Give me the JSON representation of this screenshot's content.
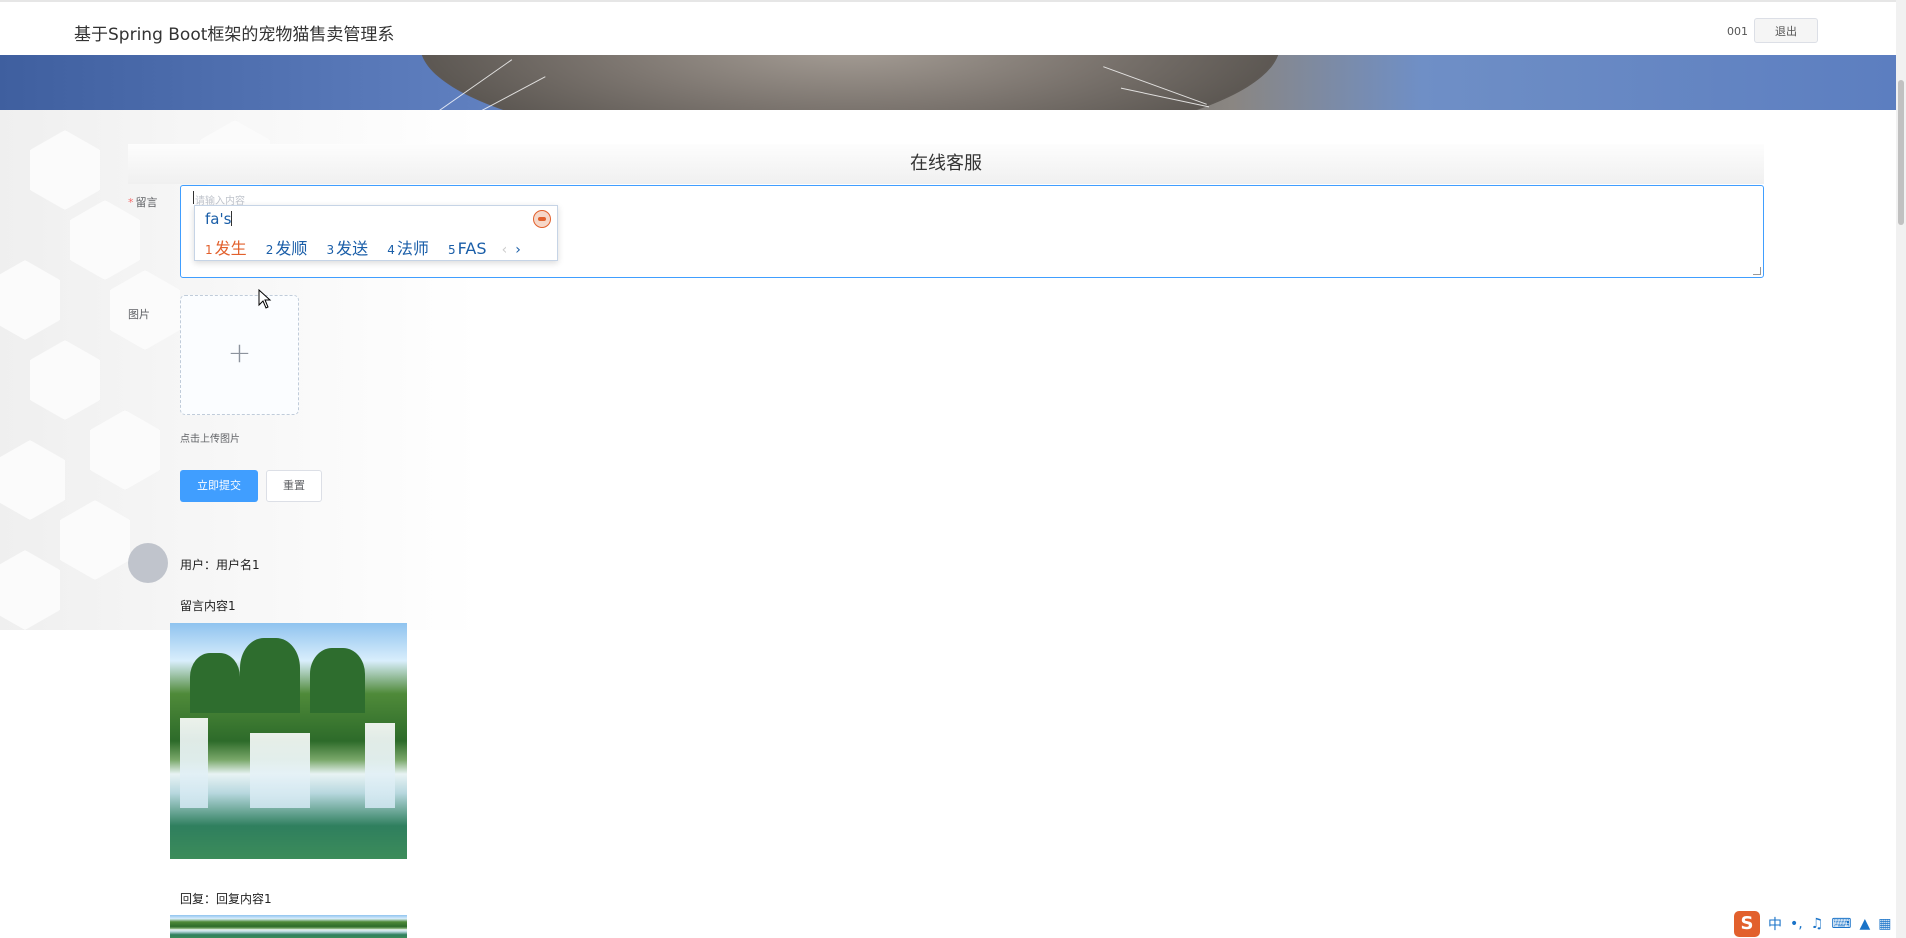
{
  "header": {
    "site_title": "基于Spring Boot框架的宠物猫售卖管理系",
    "user_id": "001",
    "logout_label": "退出"
  },
  "section": {
    "title": "在线客服"
  },
  "form": {
    "message_label": "留言",
    "required_mark": "*",
    "message_placeholder": "请输入内容",
    "image_label": "图片",
    "upload_hint": "点击上传图片",
    "submit_label": "立即提交",
    "reset_label": "重置"
  },
  "ime": {
    "pinyin": "fa's",
    "candidates": [
      {
        "num": "1",
        "text": "发生"
      },
      {
        "num": "2",
        "text": "发顺"
      },
      {
        "num": "3",
        "text": "发送"
      },
      {
        "num": "4",
        "text": "法师"
      },
      {
        "num": "5",
        "text": "FAS"
      }
    ],
    "prev": "‹",
    "next": "›",
    "tray_mode": "中"
  },
  "comments": [
    {
      "user": "用户：用户名1",
      "content": "留言内容1",
      "reply": "回复：回复内容1"
    }
  ]
}
